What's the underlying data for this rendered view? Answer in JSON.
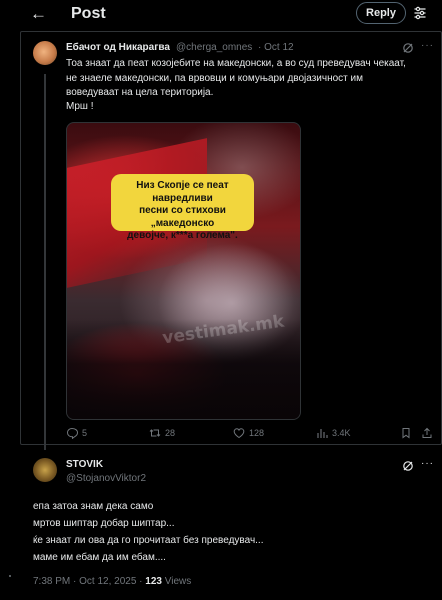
{
  "header": {
    "title": "Post",
    "reply_label": "Reply"
  },
  "quoted_post": {
    "author_name": "Ебачот од Никарагва",
    "author_handle": "@cherga_omnes",
    "date": "· Oct 12",
    "text_lines": [
      "Тоа знаат да пеат козојебите на македонски, а во суд преведувач чекаат,",
      "не знаеле македонски, па врвовци и комуњари двојазичност им",
      "воведуваат на цела територија.",
      "Мрш !"
    ],
    "media_caption_lines": [
      "Низ Скопје се пеат навредливи",
      "песни со стихови „македонско",
      "девојче, к***а голема\"."
    ],
    "media_watermark": "vestimak.mk",
    "actions": {
      "replies": "5",
      "reposts": "28",
      "likes": "128",
      "views": "3.4K"
    }
  },
  "main_post": {
    "author_name": "STOVIK",
    "author_handle": "@StojanovViktor2",
    "text_lines": [
      "епа затоа знам дека само",
      "мртов шиптар добар шиптар...",
      "ќе знаат ли ова да го прочитаат без преведувач...",
      "маме им ебам да им ебам...."
    ],
    "timestamp": "7:38 PM · Oct 12, 2025 · ",
    "views_count": "123",
    "views_label": " Views"
  },
  "icons": [
    "back-arrow-icon",
    "tune-icon",
    "grok-icon",
    "more-icon",
    "reply-icon",
    "repost-icon",
    "like-icon",
    "views-icon",
    "bookmark-icon"
  ],
  "colors": {
    "background": "#000000",
    "text_primary": "#e7e9ea",
    "text_secondary": "#71767b",
    "border": "#2f3336",
    "caption_yellow": "#f2d63d"
  }
}
